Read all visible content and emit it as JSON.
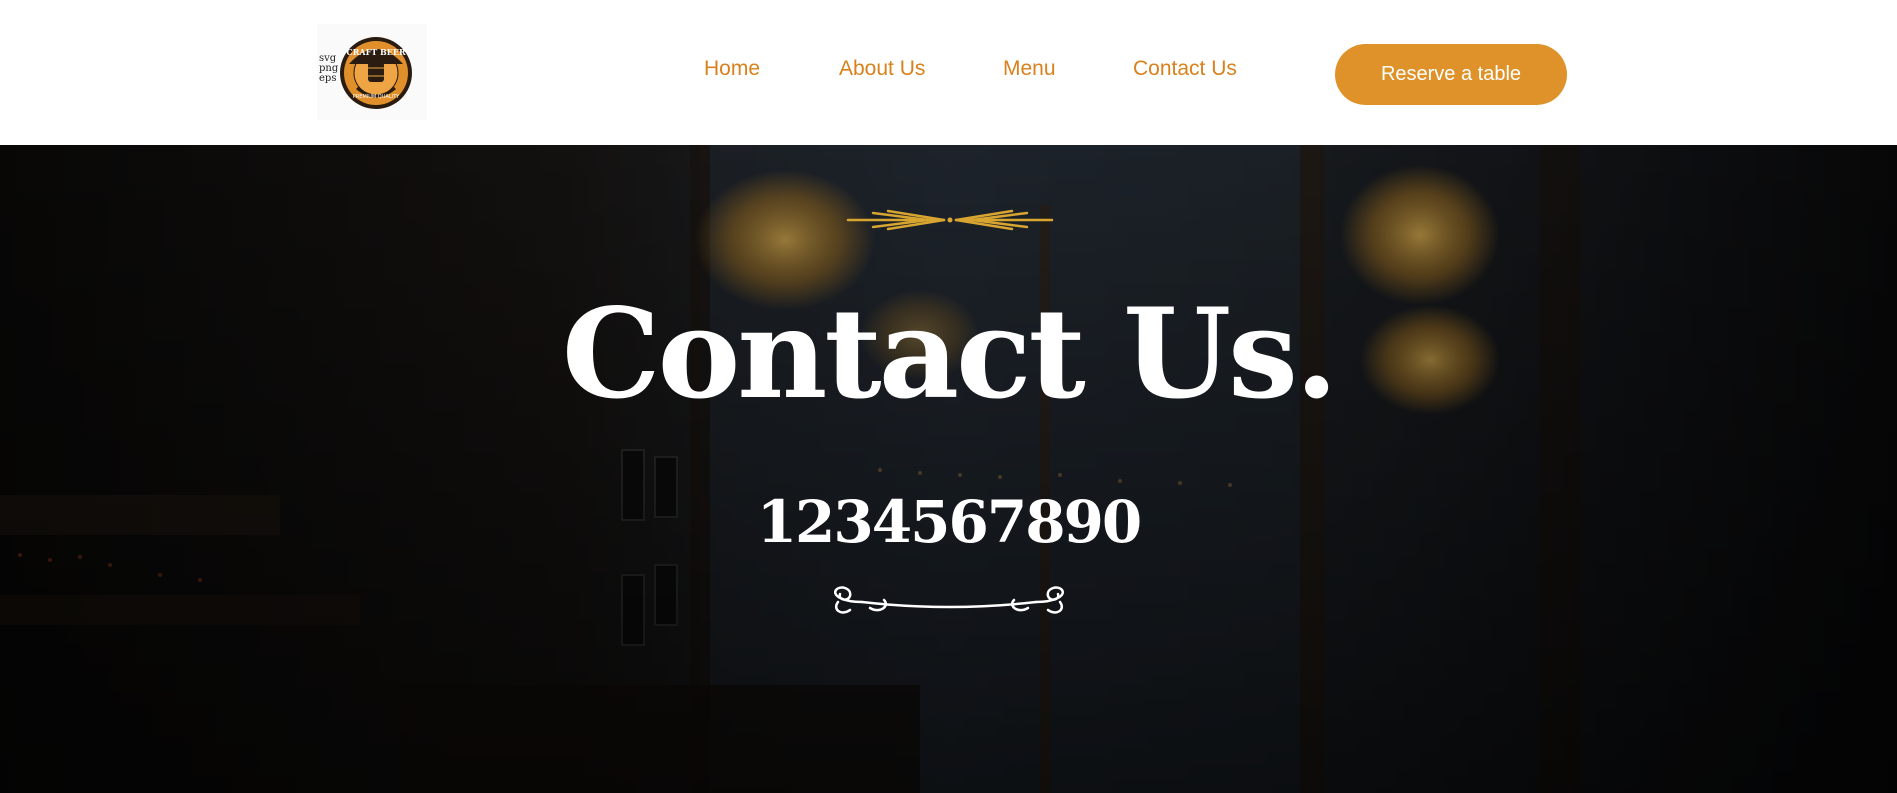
{
  "header": {
    "logo": {
      "side_text": [
        "svg",
        "png",
        "eps"
      ],
      "badge_top_text": "CRAFT BEER",
      "badge_bottom_text": "PREMIUM QUALITY",
      "badge_icon": "beer-barrel-icon"
    },
    "nav": {
      "home": "Home",
      "about": "About Us",
      "menu": "Menu",
      "contact": "Contact Us"
    },
    "reserve_label": "Reserve a table"
  },
  "hero": {
    "title": "Contact Us.",
    "phone": "1234567890",
    "top_ornament": "wheat-divider-icon",
    "bottom_ornament": "swirl-divider-icon"
  },
  "colors": {
    "accent": "#df9229",
    "nav_text": "#d9811c",
    "hero_text": "#ffffff",
    "ornament_gold": "#d9a531",
    "hero_bg": "#14161a"
  }
}
